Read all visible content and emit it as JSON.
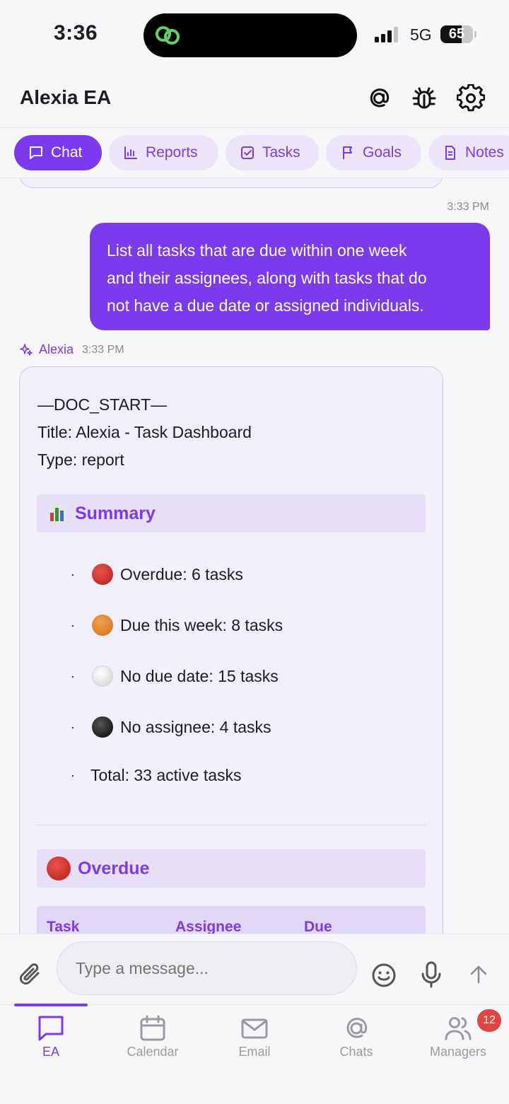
{
  "status_bar": {
    "time": "3:36",
    "network": "5G",
    "battery": "65",
    "battery_level": 0.65
  },
  "header": {
    "title": "Alexia EA"
  },
  "tabs": [
    {
      "label": "Chat",
      "icon": "chat-bubble-icon",
      "active": true
    },
    {
      "label": "Reports",
      "icon": "bar-chart-icon",
      "active": false
    },
    {
      "label": "Tasks",
      "icon": "checkbox-icon",
      "active": false
    },
    {
      "label": "Goals",
      "icon": "flag-icon",
      "active": false
    },
    {
      "label": "Notes",
      "icon": "document-icon",
      "active": false
    }
  ],
  "chat": {
    "sent": {
      "time": "3:33 PM",
      "lines": [
        "List all tasks that are due within one week",
        "and their assignees, along with tasks that do",
        "not have a due date or assigned individuals."
      ]
    },
    "reply": {
      "sender": "Alexia",
      "time": "3:33 PM",
      "doc_lines": [
        "—DOC_START—",
        "Title: Alexia - Task Dashboard",
        "Type: report"
      ],
      "summary_title": "Summary",
      "summary_items": [
        {
          "emoji": "red-circle",
          "label": "Overdue:",
          "value": "6 tasks"
        },
        {
          "emoji": "orange-circle",
          "label": "Due this week:",
          "value": "8 tasks"
        },
        {
          "emoji": "white-circle",
          "label": "No due date:",
          "value": "15 tasks"
        },
        {
          "emoji": "black-circle",
          "label": "No assignee:",
          "value": "4 tasks"
        },
        {
          "emoji": "",
          "label": "Total:",
          "value": "33 active tasks"
        }
      ],
      "overdue_title": "Overdue",
      "table_headers": [
        "Task",
        "Assignee",
        "Due"
      ]
    }
  },
  "composer": {
    "placeholder": "Type a message..."
  },
  "bottom_nav": [
    {
      "label": "EA",
      "icon": "chat-bubble-icon",
      "active": true
    },
    {
      "label": "Calendar",
      "icon": "calendar-icon",
      "active": false
    },
    {
      "label": "Email",
      "icon": "mail-icon",
      "active": false
    },
    {
      "label": "Chats",
      "icon": "at-icon",
      "active": false
    },
    {
      "label": "Managers",
      "icon": "users-icon",
      "active": false,
      "badge": "12"
    }
  ],
  "colors": {
    "accent": "#7c3aed",
    "accent_soft": "#ece4f9",
    "badge": "#e0463f"
  }
}
